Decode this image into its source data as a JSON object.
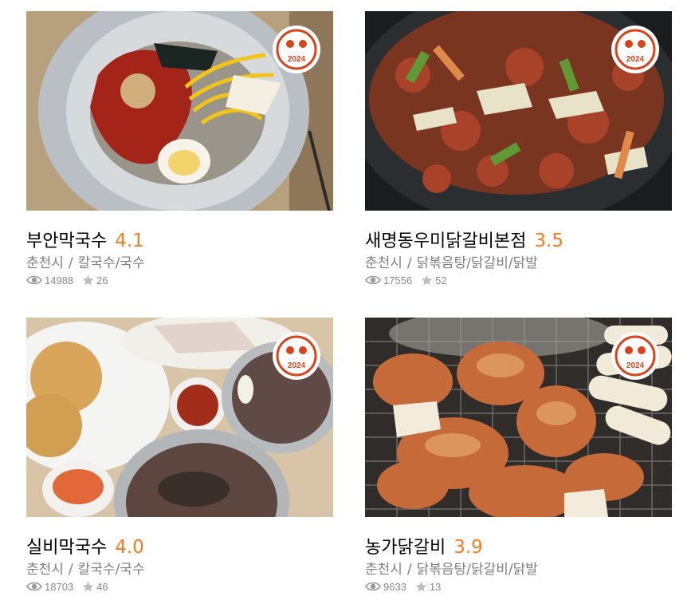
{
  "restaurants": [
    {
      "name": "부안막국수",
      "rating": "4.1",
      "city": "춘천시",
      "separator": "/",
      "category": "칼국수/국수",
      "views": "14988",
      "reviews": "26",
      "badge_year": "2024"
    },
    {
      "name": "새명동우미닭갈비본점",
      "rating": "3.5",
      "city": "춘천시",
      "separator": "/",
      "category": "닭볶음탕/닭갈비/닭발",
      "views": "17556",
      "reviews": "52",
      "badge_year": "2024"
    },
    {
      "name": "실비막국수",
      "rating": "4.0",
      "city": "춘천시",
      "separator": "/",
      "category": "칼국수/국수",
      "views": "18703",
      "reviews": "46",
      "badge_year": "2024"
    },
    {
      "name": "농가닭갈비",
      "rating": "3.9",
      "city": "춘천시",
      "separator": "/",
      "category": "닭볶음탕/닭갈비/닭발",
      "views": "9633",
      "reviews": "13",
      "badge_year": "2024"
    }
  ],
  "colors": {
    "rating": "#ff7a1a",
    "badge": "#d9431c",
    "meta": "#7f7f7f"
  },
  "icons": {
    "views": "eye-icon",
    "reviews": "star-icon",
    "badge": "award-badge-icon"
  }
}
